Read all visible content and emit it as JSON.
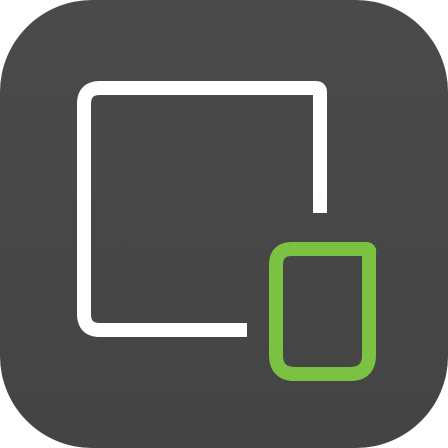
{
  "app_icon": {
    "icon": "screen-and-phone-icon",
    "colors": {
      "background": "#444444",
      "background_highlight": "#4a4a4a",
      "screen_outline": "#ffffff",
      "device_outline": "#7cc242"
    }
  }
}
